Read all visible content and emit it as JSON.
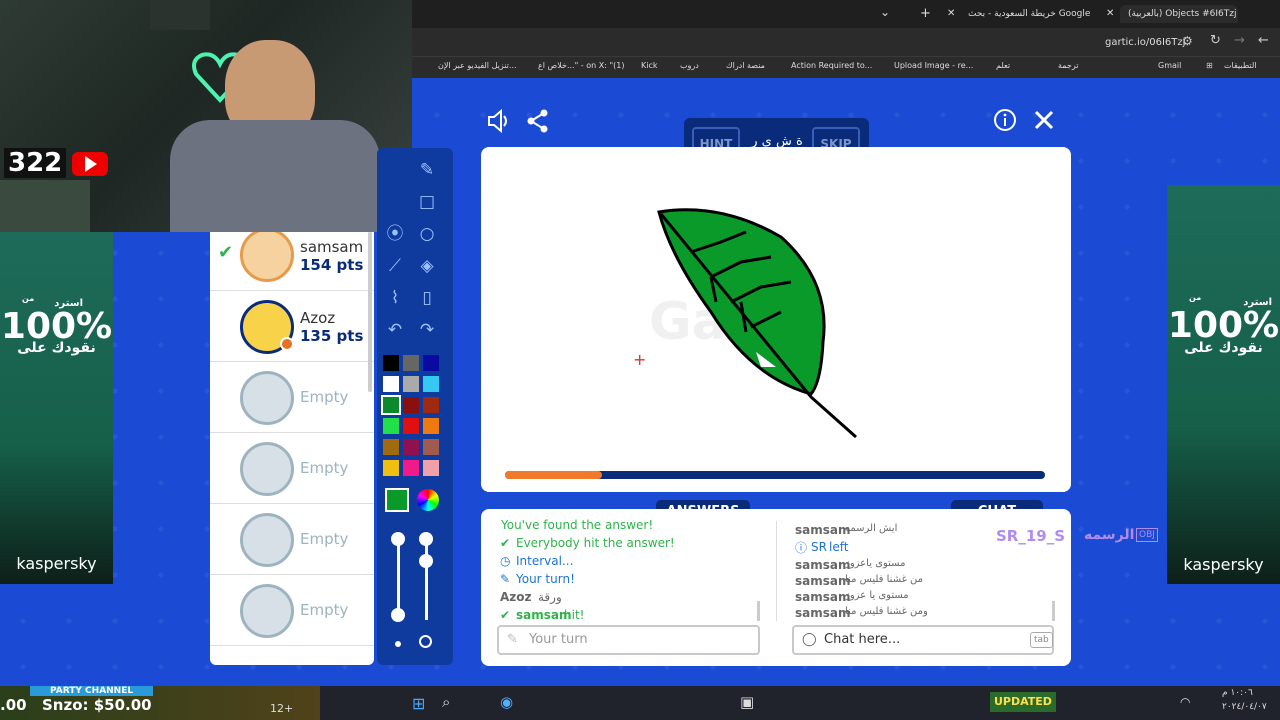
{
  "browser": {
    "tabs": [
      {
        "label": "(بالعربية) Objects #6I6Tzj"
      },
      {
        "label": "خريطة السعودية - بحث Google"
      }
    ],
    "url": "gartic.io/06I6Tzj",
    "bookmarks": [
      "التطبيقات",
      "Gmail",
      "ترجمة",
      "تعلم",
      "Upload Image - re...",
      "Action Required to...",
      "منصة ادراك",
      "دروب",
      "Kick",
      "خلاص اع...\" - on X: \"(1)",
      "تنزيل الفيديو عبر الإن..."
    ]
  },
  "stream": {
    "sub_count": "322",
    "ad_percent": "100%",
    "ad_sub": "استرد",
    "ad_line": "نقودك على",
    "ad_brand": "kaspersky",
    "ad_small": "من"
  },
  "game": {
    "word_hint": "ة ش ي ر",
    "hint_label": "HINT",
    "skip_label": "SKIP",
    "answers_header": "ANSWERS",
    "chat_header": "CHAT",
    "players": [
      {
        "name": "samsam",
        "points": "154 pts",
        "guessed": true
      },
      {
        "name": "Azoz",
        "points": "135 pts",
        "guessed": false
      },
      {
        "name": "Empty"
      },
      {
        "name": "Empty"
      },
      {
        "name": "Empty"
      },
      {
        "name": "Empty"
      }
    ],
    "answer_lines": [
      {
        "text": "You've found the answer!",
        "color": "#2fb34a"
      },
      {
        "text": "Everybody hit the answer!",
        "color": "#2fb34a"
      },
      {
        "text": "Interval...",
        "color": "#1e73d8"
      },
      {
        "text": "Your turn!",
        "color": "#1e73d8"
      },
      {
        "user": "Azoz",
        "text": "ورقة"
      },
      {
        "user": "samsam",
        "text": "hit!",
        "color": "#2fb34a"
      }
    ],
    "chat_lines": [
      {
        "user": "samsam",
        "text": "ايش الرسمه"
      },
      {
        "user": "SR",
        "text": "left",
        "color": "#1e73d8"
      },
      {
        "user": "samsam",
        "text": "مستوى ياعزوز"
      },
      {
        "user": "samsam",
        "text": "من غشنا فليس منا"
      },
      {
        "user": "samsam",
        "text": "مستوى يا عزوز"
      },
      {
        "user": "samsam",
        "text": "ومن غشنا فليس منا"
      }
    ],
    "answer_placeholder": "Your turn",
    "chat_placeholder": "Chat here...",
    "tab_key": "tab",
    "overlay_name": "SR_19_S",
    "overlay_caption": "الرسمه",
    "overlay_tag": "OBJ",
    "progress": 0.18,
    "colors": [
      "#000000",
      "#666666",
      "#0a0aa0",
      "#ffffff",
      "#aaaaaa",
      "#35c8f0",
      "#0a8a2a",
      "#8a1010",
      "#a02a10",
      "#22e04a",
      "#e01010",
      "#f07a10",
      "#a06a10",
      "#901050",
      "#a05a50",
      "#f0c010",
      "#f01a8a",
      "#f0a0a8"
    ],
    "selected_color": "#0a9a2a"
  },
  "taskbar": {
    "party_label": "PARTY CHANNEL",
    "snzo": "Snzo: $50.00",
    "left_val": ".00",
    "badge1": "12+",
    "updated": "UPDATED",
    "time": "١٠:٠٦ م",
    "date": "٢٠٢٤/٠٤/٠٧"
  }
}
